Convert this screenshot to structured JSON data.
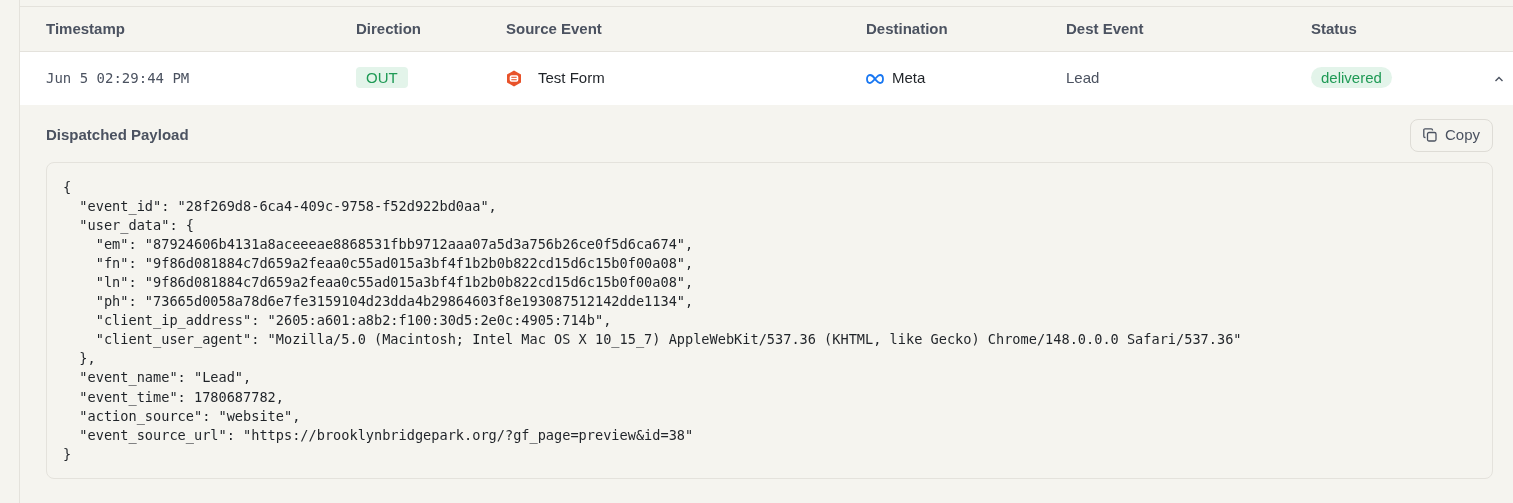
{
  "table": {
    "columns": [
      "Timestamp",
      "Direction",
      "Source Event",
      "Destination",
      "Dest Event",
      "Status"
    ],
    "rows": [
      {
        "timestamp": "Jun 5 02:29:44 PM",
        "direction": "OUT",
        "source_event": "Test Form",
        "destination": "Meta",
        "dest_event": "Lead",
        "status": "delivered",
        "expanded": true,
        "details": {
          "title": "Dispatched Payload",
          "copy_button": "Copy",
          "payload_lines": [
            "{",
            "  \"event_id\": \"28f269d8-6ca4-409c-9758-f52d922bd0aa\",",
            "  \"user_data\": {",
            "    \"em\": \"87924606b4131a8aceeeae8868531fbb9712aaa07a5d3a756b26ce0f5d6ca674\",",
            "    \"fn\": \"9f86d081884c7d659a2feaa0c55ad015a3bf4f1b2b0b822cd15d6c15b0f00a08\",",
            "    \"ln\": \"9f86d081884c7d659a2feaa0c55ad015a3bf4f1b2b0b822cd15d6c15b0f00a08\",",
            "    \"ph\": \"73665d0058a78d6e7fe3159104d23dda4b29864603f8e193087512142dde1134\",",
            "    \"client_ip_address\": \"2605:a601:a8b2:f100:30d5:2e0c:4905:714b\",",
            "    \"client_user_agent\": \"Mozilla/5.0 (Macintosh; Intel Mac OS X 10_15_7) AppleWebKit/537.36 (KHTML, like Gecko) Chrome/148.0.0.0 Safari/537.36\"",
            "  },",
            "  \"event_name\": \"Lead\",",
            "  \"event_time\": 1780687782,",
            "  \"action_source\": \"website\",",
            "  \"event_source_url\": \"https://brooklynbridgepark.org/?gf_page=preview&id=38\"",
            "}"
          ]
        }
      }
    ]
  }
}
